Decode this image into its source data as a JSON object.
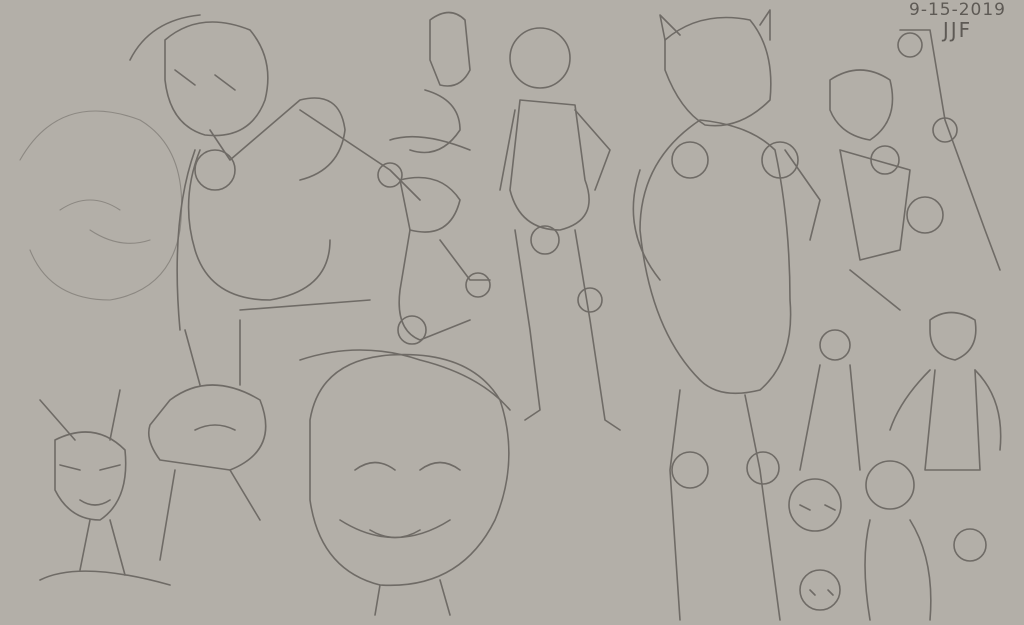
{
  "canvas": {
    "background": "#b3afa8",
    "stroke": "#6f6b66"
  },
  "signature": {
    "date": "9-15-2019",
    "initials": "JJF"
  }
}
